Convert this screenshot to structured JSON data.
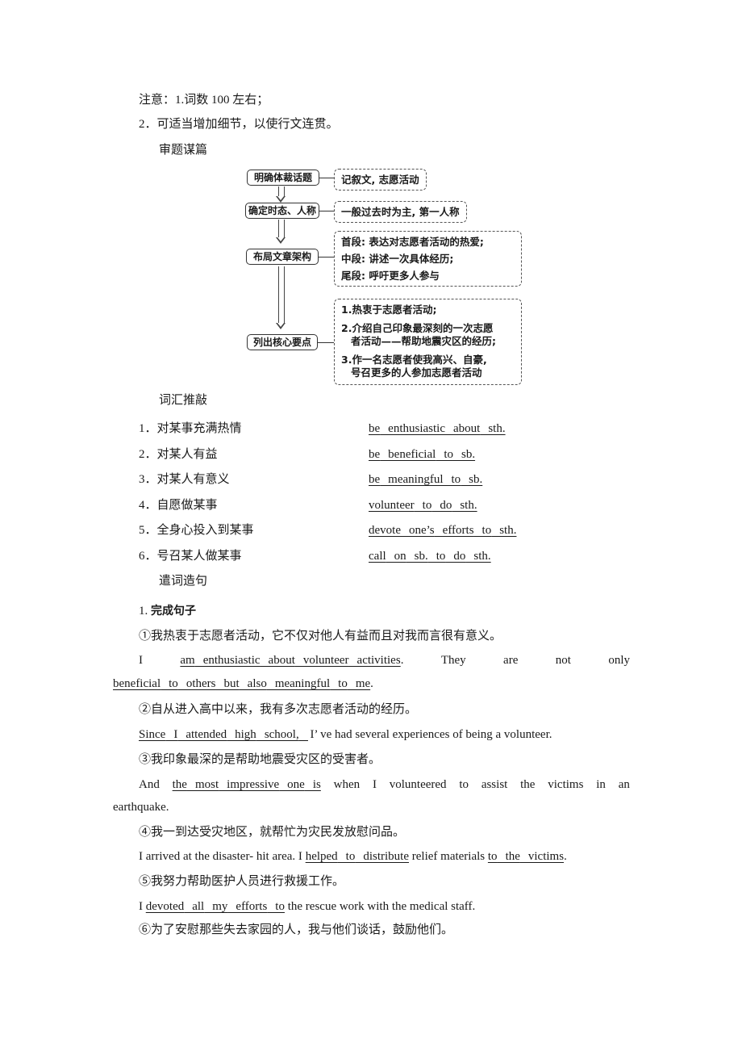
{
  "notes": {
    "note1": "注意：1.词数 100 左右；",
    "note2": "2．可适当增加细节，以使行文连贯。"
  },
  "section_review": "审题谋篇",
  "flowchart": {
    "steps": [
      {
        "label": "明确体裁话题",
        "detail": [
          "记叙文, 志愿活动"
        ]
      },
      {
        "label": "确定时态、人称",
        "detail": [
          "一般过去时为主, 第一人称"
        ]
      },
      {
        "label": "布局文章架构",
        "detail": [
          "首段: 表达对志愿者活动的热爱;",
          "中段: 讲述一次具体经历;",
          "尾段: 呼吁更多人参与"
        ]
      },
      {
        "label": "列出核心要点",
        "detail": [
          "1.热衷于志愿者活动;",
          "2.介绍自己印象最深刻的一次志愿",
          "者活动——帮助地震灾区的经历;",
          "3.作一名志愿者使我高兴、自豪,",
          "号召更多的人参加志愿者活动"
        ]
      }
    ]
  },
  "section_vocab": "词汇推敲",
  "vocab": [
    {
      "num": "1．",
      "cn": "对某事充满热情",
      "en": [
        "be",
        "enthusiastic",
        "about",
        "sth."
      ]
    },
    {
      "num": "2．",
      "cn": "对某人有益",
      "en": [
        "be",
        "beneficial",
        "to",
        "sb."
      ]
    },
    {
      "num": "3．",
      "cn": "对某人有意义",
      "en": [
        "be",
        "meaningful",
        "to",
        "sb."
      ]
    },
    {
      "num": "4．",
      "cn": "自愿做某事",
      "en": [
        "volunteer",
        "to",
        "do",
        "sth."
      ]
    },
    {
      "num": "5．",
      "cn": "全身心投入到某事",
      "en": [
        "devote",
        "one’s",
        "efforts",
        "to",
        "sth."
      ]
    },
    {
      "num": "6．",
      "cn": "号召某人做某事",
      "en": [
        "call",
        "on",
        "sb.",
        "to",
        "do",
        "sth."
      ]
    }
  ],
  "section_sentences": "遣词造句",
  "exercise_title_num": "1.",
  "exercise_title": "完成句子",
  "sentences": {
    "s1_cn": "①我热衷于志愿者活动，它不仅对他人有益而且对我而言很有意义。",
    "s1_en_a": "I",
    "s1_en_blank1": [
      "am",
      "enthusiastic",
      "about",
      "volunteer",
      "activities"
    ],
    "s1_en_b": [
      "They",
      "are",
      "not",
      "only"
    ],
    "s1_en_blank2": [
      "beneficial",
      "to",
      "others",
      "but",
      "also",
      "meaningful",
      "to",
      "me"
    ],
    "s2_cn": "②自从进入高中以来，我有多次志愿者活动的经历。",
    "s2_blank": [
      "Since",
      "I",
      "attended",
      "high",
      "school,"
    ],
    "s2_rest": "I’ ve had several experiences of being a volunteer.",
    "s3_cn": "③我印象最深的是帮助地震受灾区的受害者。",
    "s3_a": "And",
    "s3_blank": [
      "the",
      "most",
      "impressive",
      "one",
      "is"
    ],
    "s3_rest": [
      "when",
      "I",
      "volunteered",
      "to",
      "assist",
      "the",
      "victims",
      "in",
      "an"
    ],
    "s3_cont": "earthquake.",
    "s4_cn": "④我一到达受灾地区，就帮忙为灾民发放慰问品。",
    "s4_a": "I arrived at the disaster- hit area. I",
    "s4_blank1": [
      "helped",
      "to",
      "distribute"
    ],
    "s4_b": "relief materials",
    "s4_blank2": [
      "to",
      "the",
      "victims"
    ],
    "s5_cn": "⑤我努力帮助医护人员进行救援工作。",
    "s5_a": "I",
    "s5_blank": [
      "devoted",
      "all",
      "my",
      "efforts",
      "to"
    ],
    "s5_rest": "the rescue work with the medical staff.",
    "s6_cn": "⑥为了安慰那些失去家园的人，我与他们谈话，鼓励他们。"
  }
}
